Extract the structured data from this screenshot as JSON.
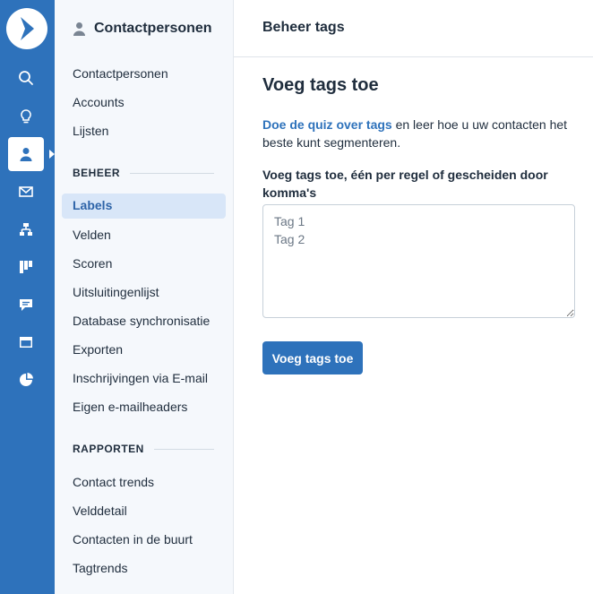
{
  "sidebar": {
    "header_title": "Contactpersonen",
    "top_links": [
      {
        "label": "Contactpersonen"
      },
      {
        "label": "Accounts"
      },
      {
        "label": "Lijsten"
      }
    ],
    "section_beheer": "BEHEER",
    "active_item": "Labels",
    "beheer_links": [
      {
        "label": "Velden"
      },
      {
        "label": "Scoren"
      },
      {
        "label": "Uitsluitingenlijst"
      },
      {
        "label": "Database synchronisatie"
      },
      {
        "label": "Exporten"
      },
      {
        "label": "Inschrijvingen via E-mail"
      },
      {
        "label": "Eigen e-mailheaders"
      }
    ],
    "section_rapporten": "RAPPORTEN",
    "rapporten_links": [
      {
        "label": "Contact trends"
      },
      {
        "label": "Velddetail"
      },
      {
        "label": "Contacten in de buurt"
      },
      {
        "label": "Tagtrends"
      }
    ]
  },
  "rail": {
    "icons": [
      "search-icon",
      "lightbulb-icon",
      "contacts-icon",
      "mail-icon",
      "automation-icon",
      "pipeline-icon",
      "conversations-icon",
      "site-icon",
      "reports-icon"
    ],
    "active_icon": "contacts-icon",
    "bg_color": "#2e72bb"
  },
  "main": {
    "header_title": "Beheer tags",
    "page_title": "Voeg tags toe",
    "intro_link": "Doe de quiz over tags",
    "intro_text": " en leer hoe u uw contacten het beste kunt segmenteren.",
    "field_label": "Voeg tags toe, één per regel of gescheiden door komma's",
    "textarea_placeholder": "Tag 1\nTag 2",
    "submit_label": "Voeg tags toe"
  }
}
